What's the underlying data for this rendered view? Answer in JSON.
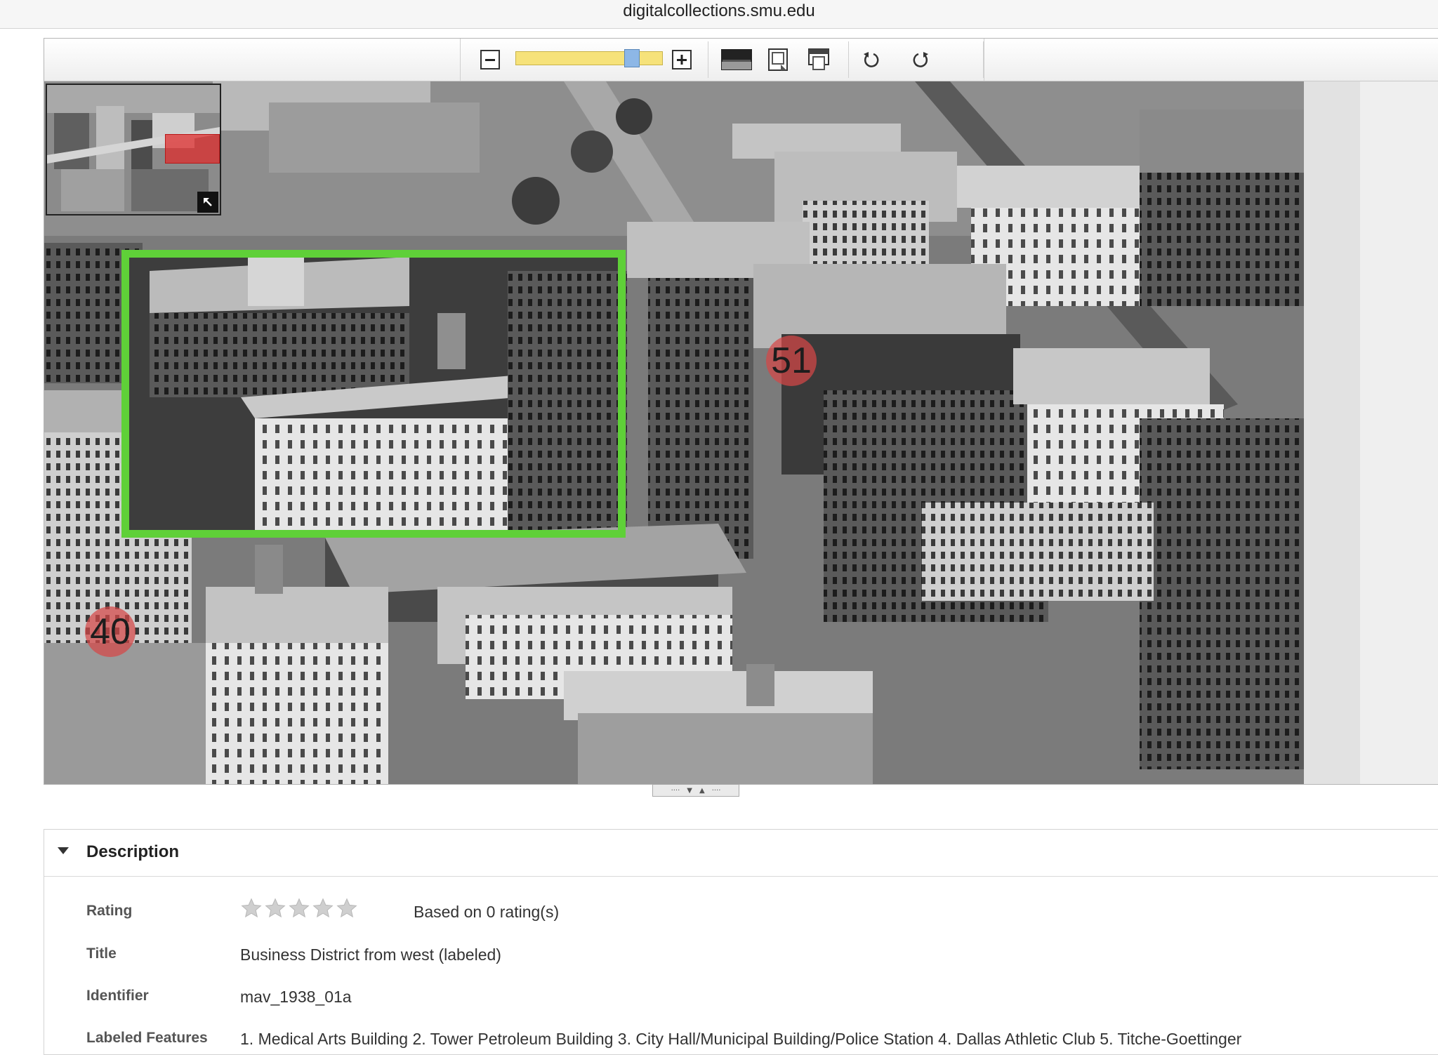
{
  "browser": {
    "domain": "digitalcollections.smu.edu"
  },
  "viewer": {
    "toolbar": {
      "zoom_out": "zoom-out-icon",
      "zoom_in": "zoom-in-icon",
      "zoom_level": 0.83,
      "buttons": [
        "toggle-contrast-icon",
        "fit-width-icon",
        "fit-height-icon",
        "rotate-left-icon",
        "rotate-right-icon"
      ]
    },
    "markers": [
      {
        "number": "51"
      },
      {
        "number": "40"
      }
    ],
    "overlay_colors": {
      "highlight_box": "#5fd038",
      "marker": "#d64646",
      "minimap_view": "#e12828"
    }
  },
  "description": {
    "heading": "Description",
    "rating": {
      "label": "Rating",
      "stars_filled": 0,
      "stars_total": 5,
      "text": "Based on 0 rating(s)"
    },
    "title": {
      "label": "Title",
      "value": "Business District from west (labeled)"
    },
    "identifier": {
      "label": "Identifier",
      "value": "mav_1938_01a"
    },
    "labeled_features": {
      "label": "Labeled Features",
      "value": "1. Medical Arts Building 2. Tower Petroleum Building 3. City Hall/Municipal Building/Police Station 4. Dallas Athletic Club 5. Titche-Goettinger"
    }
  }
}
